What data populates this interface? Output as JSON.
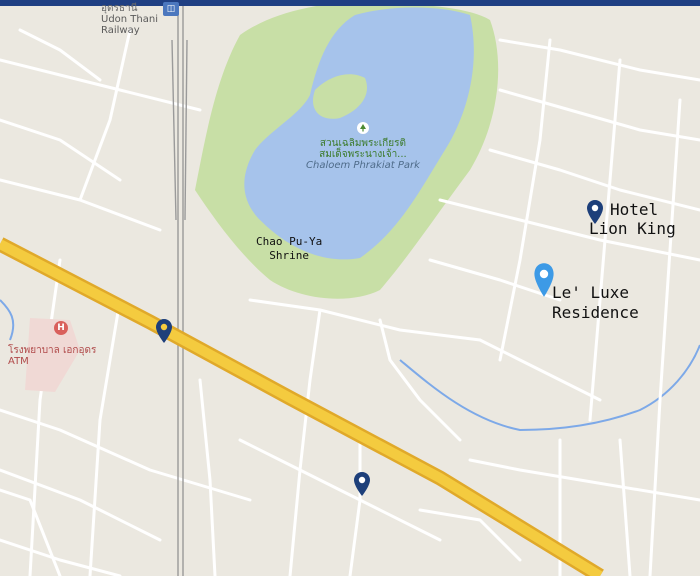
{
  "station": {
    "name": "Udon Thani Railway",
    "line1": "Udon Thani",
    "line2": "Railway",
    "thai": "อุดรธานี"
  },
  "park": {
    "thai_line1": "สวนเฉลิมพระเกียรติ",
    "thai_line2": "สมเด็จพระนางเจ้า...",
    "english": "Chaloem Phrakiat Park",
    "icon": "tree-icon"
  },
  "shrine": {
    "line1": "Chao Pu-Ya",
    "line2": "Shrine"
  },
  "hospital": {
    "icon_letter": "H",
    "thai": "โรงพยาบาล เอกอุดร",
    "sub": "ATM"
  },
  "hotel": {
    "line1": "Hotel",
    "line2": "Lion King",
    "pin_icon": "map-pin-icon"
  },
  "residence": {
    "line1": "Le' Luxe",
    "line2": "Residence",
    "pin_icon": "map-pin-icon"
  },
  "markers": [
    {
      "name": "hotel-lion-king-pin",
      "color": "#1d3f7a"
    },
    {
      "name": "le-luxe-residence-pin",
      "color": "#3d9ae6"
    },
    {
      "name": "hospital-area-pin",
      "color": "#1d3f7a"
    },
    {
      "name": "south-pin",
      "color": "#1d3f7a"
    }
  ],
  "colors": {
    "land": "#ebe8e0",
    "road": "#ffffff",
    "highway": "#f4cb3f",
    "highway_edge": "#e0a92a",
    "park": "#c8dfa6",
    "water": "#a6c3eb",
    "stream": "#7da9e8",
    "rail": "#9a9a9a",
    "topbar": "#1f3f83"
  }
}
